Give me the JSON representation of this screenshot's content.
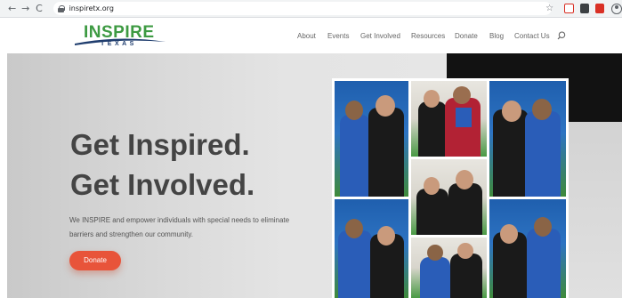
{
  "browser": {
    "url": "inspiretx.org",
    "back_icon": "←",
    "forward_icon": "→",
    "reload_icon": "C",
    "star_icon": "☆",
    "extensions": [
      "shield-extension",
      "dark-extension",
      "pdf-extension"
    ]
  },
  "site": {
    "logo": {
      "word": "INSPIRE",
      "sub": "TEXAS",
      "accent_color": "#3d9a42",
      "sub_color": "#1f3d6e"
    },
    "nav": [
      "About",
      "Events",
      "Get Involved",
      "Resources",
      "Donate",
      "Blog",
      "Contact Us"
    ]
  },
  "hero": {
    "title_line1": "Get Inspired.",
    "title_line2": "Get Involved.",
    "description": "We INSPIRE and empower individuals with special needs to eliminate barriers and strengthen our community.",
    "cta_label": "Donate",
    "cta_color": "#e8543a"
  }
}
